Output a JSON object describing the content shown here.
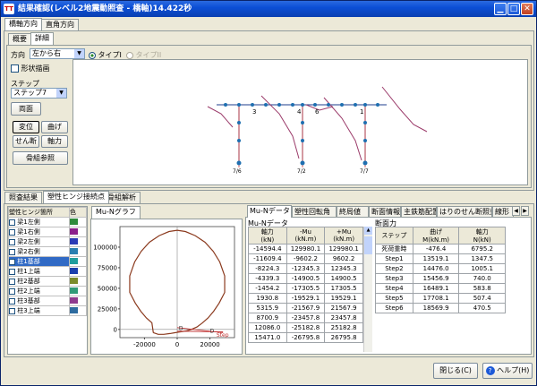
{
  "window": {
    "title": "結果確認(レベル2地震動照査 - 橋軸)14.422秒",
    "minimize_icon": "minimize-icon",
    "maximize_icon": "maximize-icon",
    "close_icon": "close-icon"
  },
  "direction_tabs": [
    "橋軸方向",
    "直角方向"
  ],
  "view_tabs": [
    "概要",
    "詳細"
  ],
  "controls": {
    "direction_label": "方向",
    "direction_value": "左から右",
    "type1_label": "タイプI",
    "type2_label": "タイプII",
    "shape_label": "形状描画",
    "step_label": "ステップ",
    "step_value": "ステップ7",
    "reset_btn": "両面",
    "disp_btn": "変位",
    "bend_btn": "曲げ",
    "shear_btn": "せん断",
    "axial_btn": "軸力",
    "ref_btn": "骨組参照"
  },
  "frame_labels": {
    "node_top": [
      "3",
      "4",
      "6",
      "1"
    ],
    "node_bottom": [
      "7/6",
      "7/2",
      "7/7"
    ]
  },
  "bottom_tabs": [
    "照査結果",
    "塑性ヒンジ接続点",
    "骨組解析"
  ],
  "hinge_list": {
    "headers": [
      "塑性ヒンジ箇所",
      "色"
    ],
    "items": [
      {
        "label": "梁1左側",
        "color": "#2e8b3c",
        "selected": false
      },
      {
        "label": "梁1右側",
        "color": "#8b1f8b",
        "selected": false
      },
      {
        "label": "梁2左側",
        "color": "#2b3bb5",
        "selected": false
      },
      {
        "label": "梁2右側",
        "color": "#2a7fb0",
        "selected": false
      },
      {
        "label": "柱1基部",
        "color": "#1f9d9d",
        "selected": true
      },
      {
        "label": "柱1上端",
        "color": "#1b3fae",
        "selected": false
      },
      {
        "label": "柱2基部",
        "color": "#7a8b2a",
        "selected": false
      },
      {
        "label": "柱2上端",
        "color": "#2f9a77",
        "selected": false
      },
      {
        "label": "柱3基部",
        "color": "#8e3a8e",
        "selected": false
      },
      {
        "label": "柱3上端",
        "color": "#2d6b9f",
        "selected": false
      }
    ]
  },
  "graph_tab": "Mu-Nグラフ",
  "chart_data": {
    "type": "line",
    "title": "",
    "xlabel": "",
    "ylabel": "",
    "xlim": [
      -35000,
      35000
    ],
    "ylim": [
      -10000,
      125000
    ],
    "x_ticks": [
      -20000,
      0,
      20000
    ],
    "y_ticks": [
      0,
      25000,
      50000,
      75000,
      100000
    ],
    "series": [
      {
        "name": "",
        "color": "#8b3a1e",
        "x": [
          -14594.4,
          -11609.4,
          -8224.3,
          -4339.3,
          -1454.2,
          1930.8,
          5315.9,
          8700.9,
          12086.0,
          15471.0,
          18856.1,
          22241.1,
          25626.2,
          29011.2,
          29011.2,
          26000,
          22000,
          17000,
          11000,
          5000,
          0,
          -5000,
          -11000,
          -17000,
          -22000,
          -26000,
          -29011.2,
          -29011.2,
          -25626.2,
          -22241.1,
          -18856.1,
          -15471.0,
          -14594.4
        ],
        "y": [
          -4000,
          -6000,
          -6000,
          -5000,
          -4000,
          -3000,
          -2000,
          0,
          3000,
          8000,
          14000,
          22000,
          32000,
          45000,
          65000,
          82000,
          95000,
          106000,
          114000,
          119000,
          120500,
          119000,
          114000,
          106000,
          95000,
          82000,
          65000,
          45000,
          32000,
          22000,
          14000,
          8000,
          -4000
        ]
      }
    ],
    "annotations": [
      "D",
      "D",
      "Step"
    ]
  },
  "data_tabs": [
    "Mu-Nデータ",
    "塑性回転角",
    "終局値",
    "断面情報",
    "主鉄筋配置",
    "はりのせん断照査",
    "線形"
  ],
  "mu_table": {
    "caption": "Mu-Nデータ",
    "headers": [
      "軸力\n(kN)",
      "-Mu\n(kN.m)",
      "+Mu\n(kN.m)"
    ],
    "rows": [
      [
        "-14594.4",
        "129980.1",
        "129980.1"
      ],
      [
        "-11609.4",
        "-9602.2",
        "9602.2"
      ],
      [
        "-8224.3",
        "-12345.3",
        "12345.3"
      ],
      [
        "-4339.3",
        "-14900.5",
        "14900.5"
      ],
      [
        "-1454.2",
        "-17305.5",
        "17305.5"
      ],
      [
        "1930.8",
        "-19529.1",
        "19529.1"
      ],
      [
        "5315.9",
        "-21567.9",
        "21567.9"
      ],
      [
        "8700.9",
        "-23457.8",
        "23457.8"
      ],
      [
        "12086.0",
        "-25182.8",
        "25182.8"
      ],
      [
        "15471.0",
        "-26795.8",
        "26795.8"
      ]
    ]
  },
  "step_table": {
    "caption": "断面力",
    "headers": [
      "ステップ",
      "曲げ\nM(kN.m)",
      "軸力\nN(kN)"
    ],
    "rows": [
      [
        "死荷重時",
        "-476.4",
        "6795.2"
      ],
      [
        "Step1",
        "13519.1",
        "1347.5"
      ],
      [
        "Step2",
        "14476.0",
        "1005.1"
      ],
      [
        "Step3",
        "15456.9",
        "740.0"
      ],
      [
        "Step4",
        "16489.1",
        "583.8"
      ],
      [
        "Step5",
        "17708.1",
        "507.4"
      ],
      [
        "Step6",
        "18569.9",
        "470.5"
      ]
    ]
  },
  "footer": {
    "close_btn": "閉じる(C)",
    "help_btn": "ヘルプ(H)",
    "help_icon": "question-icon"
  }
}
